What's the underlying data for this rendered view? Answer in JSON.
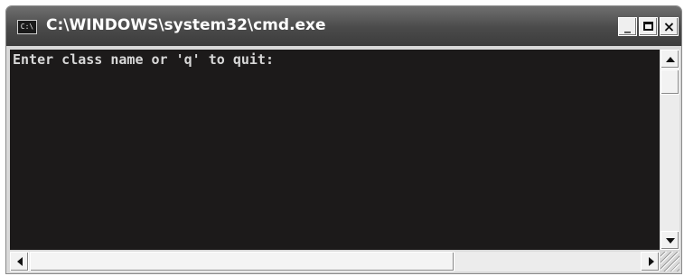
{
  "window": {
    "icon_label": "C:\\",
    "title": "C:\\WINDOWS\\system32\\cmd.exe",
    "controls": {
      "minimize": "_",
      "close": "×"
    }
  },
  "console": {
    "lines": [
      "Enter class name or 'q' to quit:"
    ]
  },
  "icons": [
    "cmd-icon",
    "minimize-icon",
    "maximize-icon",
    "close-icon",
    "arrow-up-icon",
    "arrow-down-icon",
    "arrow-left-icon",
    "arrow-right-icon",
    "resize-grip-icon"
  ],
  "colors": {
    "console_bg": "#1c1a1a",
    "console_text": "#d8d8d8",
    "titlebar": "#4a4a4a"
  }
}
